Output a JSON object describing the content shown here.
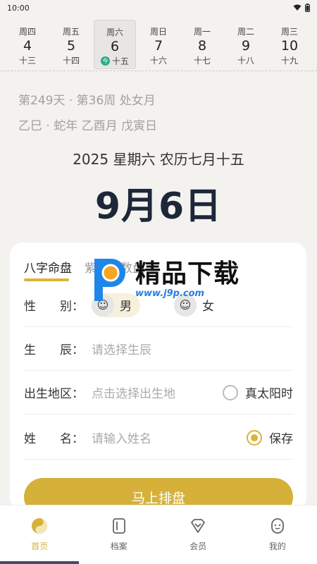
{
  "status": {
    "time": "10:00"
  },
  "week": [
    {
      "weekday": "周四",
      "day": "4",
      "lunar": "十三",
      "selected": false
    },
    {
      "weekday": "周五",
      "day": "5",
      "lunar": "十四",
      "selected": false
    },
    {
      "weekday": "周六",
      "day": "6",
      "lunar": "十五",
      "selected": true,
      "badge": "今"
    },
    {
      "weekday": "周日",
      "day": "7",
      "lunar": "十六",
      "selected": false
    },
    {
      "weekday": "周一",
      "day": "8",
      "lunar": "十七",
      "selected": false
    },
    {
      "weekday": "周二",
      "day": "9",
      "lunar": "十八",
      "selected": false
    },
    {
      "weekday": "周三",
      "day": "10",
      "lunar": "十九",
      "selected": false
    }
  ],
  "info": {
    "line1": "第249天 · 第36周 处女月",
    "line2": "乙巳 · 蛇年 乙酉月 戊寅日",
    "full_date": "2025 星期六 农历七月十五",
    "big_date": "9月6日"
  },
  "card": {
    "tab_active": "八字命盘",
    "tab_inactive": "紫微斗数盘",
    "gender_label": "性　　别：",
    "male": "男",
    "female": "女",
    "birth_label": "生　　辰：",
    "birth_placeholder": "请选择生辰",
    "region_label": "出生地区：",
    "region_placeholder": "点击选择出生地",
    "solar_time": "真太阳时",
    "name_label": "姓　　名：",
    "name_placeholder": "请输入姓名",
    "save": "保存",
    "submit": "马上排盘"
  },
  "watermark": {
    "main": "精品下载",
    "sub": "www.j9p.com"
  },
  "tabbar": [
    {
      "label": "首页",
      "icon": "yin-yang-icon",
      "active": true
    },
    {
      "label": "档案",
      "icon": "folder-icon",
      "active": false
    },
    {
      "label": "会员",
      "icon": "vip-icon",
      "active": false
    },
    {
      "label": "我的",
      "icon": "profile-icon",
      "active": false
    }
  ],
  "colors": {
    "accent": "#d6b13a",
    "badge": "#2eaa8a",
    "date": "#1e2738"
  }
}
